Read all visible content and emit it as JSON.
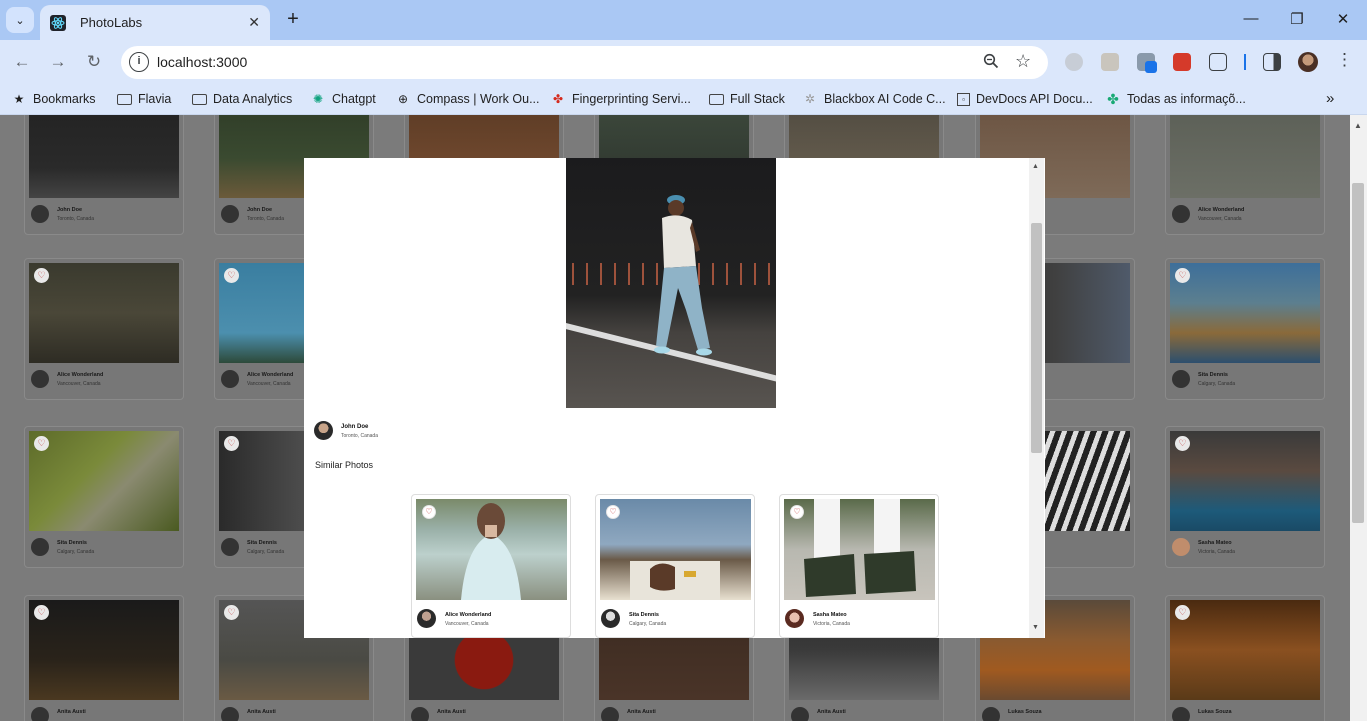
{
  "browser": {
    "tab_title": "PhotoLabs",
    "url": "localhost:3000",
    "bookmarks": [
      {
        "label": "Bookmarks",
        "icon": "star-icon"
      },
      {
        "label": "Flavia",
        "icon": "folder-icon"
      },
      {
        "label": "Data Analytics",
        "icon": "folder-icon"
      },
      {
        "label": "Chatgpt",
        "icon": "chatgpt-icon"
      },
      {
        "label": "Compass | Work Ou...",
        "icon": "compass-icon"
      },
      {
        "label": "Fingerprinting Servi...",
        "icon": "maple-leaf-icon"
      },
      {
        "label": "Full Stack",
        "icon": "folder-icon"
      },
      {
        "label": "Blackbox AI Code C...",
        "icon": "blackbox-icon"
      },
      {
        "label": "DevDocs API Docu...",
        "icon": "devdocs-icon"
      },
      {
        "label": "Todas as informaçõ...",
        "icon": "clover-icon"
      }
    ]
  },
  "grid": {
    "row1": [
      {
        "name": "John Doe",
        "location": "Toronto, Canada"
      },
      {
        "name": "John Doe",
        "location": "Toronto, Canada"
      },
      {
        "name": "",
        "location": ""
      },
      {
        "name": "",
        "location": ""
      },
      {
        "name": "",
        "location": ""
      },
      {
        "name": "",
        "location": ""
      },
      {
        "name": "Alice Wonderland",
        "location": "Vancouver, Canada"
      }
    ],
    "row2": [
      {
        "name": "Alice Wonderland",
        "location": "Vancouver, Canada"
      },
      {
        "name": "Alice Wonderland",
        "location": "Vancouver, Canada"
      },
      {
        "name": "Sita Dennis",
        "location": "Calgary, Canada"
      }
    ],
    "row3": [
      {
        "name": "Sita Dennis",
        "location": "Calgary, Canada"
      },
      {
        "name": "Sita Dennis",
        "location": "Calgary, Canada"
      },
      {
        "name": "Sasha Mateo",
        "location": "Victoria, Canada"
      }
    ],
    "row4": [
      {
        "name": "Anita Austi"
      },
      {
        "name": "Anita Austi"
      },
      {
        "name": "Anita Austi"
      },
      {
        "name": "Anita Austi"
      },
      {
        "name": "Anita Austi"
      },
      {
        "name": "Lukas Souza"
      },
      {
        "name": "Lukas Souza"
      }
    ]
  },
  "modal": {
    "author_name": "John Doe",
    "author_location": "Toronto, Canada",
    "similar_title": "Similar Photos",
    "similar": [
      {
        "name": "Alice Wonderland",
        "location": "Vancouver, Canada"
      },
      {
        "name": "Sita Dennis",
        "location": "Calgary, Canada"
      },
      {
        "name": "Sasha Mateo",
        "location": "Victoria, Canada"
      }
    ]
  },
  "colors": {
    "accent": "#aac8f4",
    "heart": "#c03030",
    "overlay": "#7b7b7b"
  }
}
